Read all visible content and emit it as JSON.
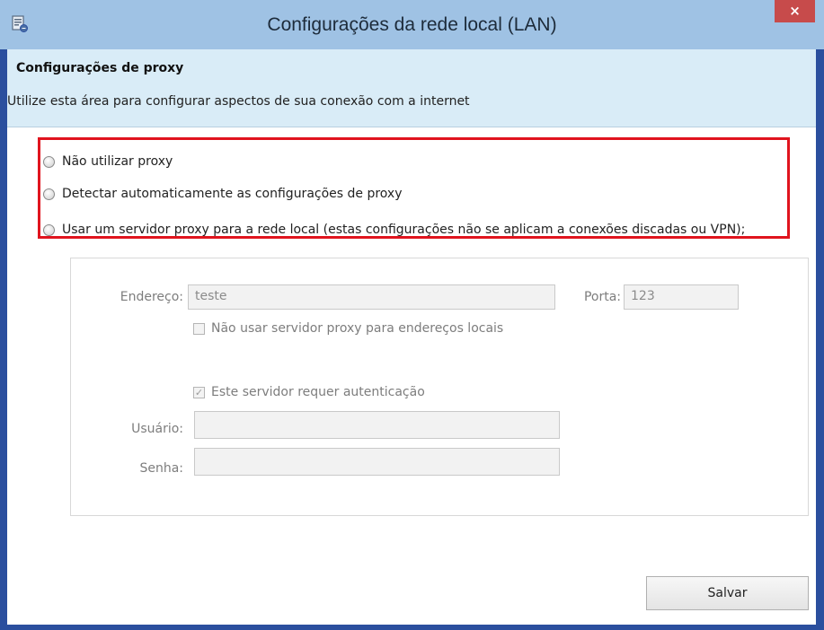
{
  "window": {
    "title": "Configurações da rede local (LAN)",
    "close_glyph": "×",
    "app_icon": "lan-settings-icon",
    "colors": {
      "titlebar": "#9fc2e4",
      "frame": "#2b4f9e",
      "close_button": "#c74b4b",
      "header_band": "#d9ecf7",
      "highlight_border": "#e0141e"
    }
  },
  "header": {
    "title": "Configurações de proxy",
    "subtitle": "Utilize esta área para configurar aspectos de sua conexão com a internet"
  },
  "proxy_options": [
    {
      "label": "Não utilizar proxy",
      "selected": false
    },
    {
      "label": "Detectar automaticamente as configurações de proxy",
      "selected": false
    },
    {
      "label": "Usar um servidor proxy para a rede local (estas configurações não se aplicam a conexões discadas ou VPN);",
      "selected": false
    }
  ],
  "proxy_settings": {
    "address_label": "Endereço:",
    "address_value": "teste",
    "port_label": "Porta:",
    "port_value": "123",
    "bypass_local_label": "Não usar servidor proxy para endereços locais",
    "bypass_local_checked": false,
    "auth_required_label": "Este servidor requer autenticação",
    "auth_required_checked": true,
    "check_glyph": "✓",
    "user_label": "Usuário:",
    "user_value": "",
    "password_label": "Senha:",
    "password_value": "",
    "disabled": true
  },
  "footer": {
    "save_label": "Salvar"
  }
}
